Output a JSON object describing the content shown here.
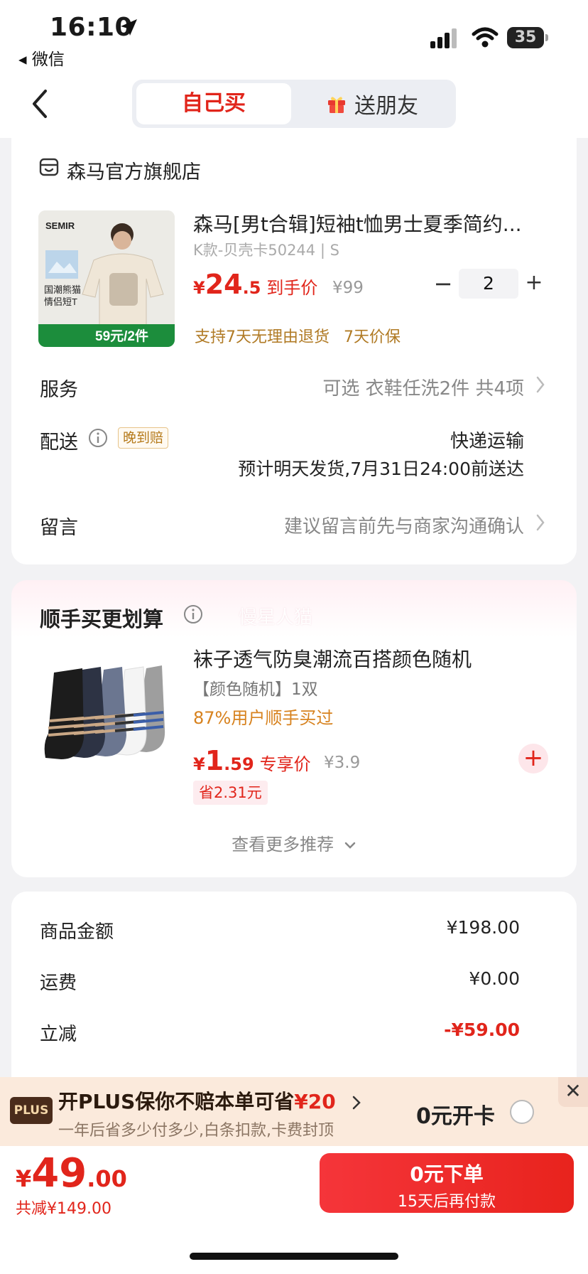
{
  "status_bar": {
    "time": "16:10",
    "back_app": "◂ 微信",
    "battery": "35"
  },
  "header": {
    "tab_self": "自己买",
    "tab_friend": "送朋友"
  },
  "store": {
    "name": "森马官方旗舰店"
  },
  "product": {
    "title": "森马[男t合辑]短袖t恤男士夏季简约...",
    "spec": "K款-贝壳卡50244 | S",
    "price_symbol": "¥",
    "price_int": "24",
    "price_dec": ".5",
    "price_tag": "到手价",
    "orig_price": "¥99",
    "qty_minus": "−",
    "qty": "2",
    "qty_plus": "+",
    "promise_1": "支持7天无理由退货",
    "promise_2": "7天价保",
    "image_text": {
      "brand": "SEMIR",
      "slogan_1": "国潮熊猫",
      "slogan_2": "情侣短T",
      "badge": "59元/2件"
    }
  },
  "service": {
    "label": "服务",
    "value": "可选 衣鞋任洗2件 共4项"
  },
  "delivery": {
    "label": "配送",
    "badge": "晚到赔",
    "method": "快递运输",
    "eta": "预计明天发货,7月31日24:00前送达"
  },
  "message": {
    "label": "留言",
    "placeholder": "建议留言前先与商家沟通确认"
  },
  "recommend": {
    "title": "顺手买更划算",
    "watermark": "慢星人猫",
    "item": {
      "title": "袜子透气防臭潮流百搭颜色随机",
      "spec": "【颜色随机】1双",
      "bought": "87%用户顺手买过",
      "price_symbol": "¥",
      "price_int": "1",
      "price_dec": ".59",
      "price_tag": "专享价",
      "orig_price": "¥3.9",
      "save": "省2.31元",
      "add": "+"
    },
    "more": "查看更多推荐"
  },
  "summary": [
    {
      "label": "商品金额",
      "value": "¥198.00",
      "red": false
    },
    {
      "label": "运费",
      "value": "¥0.00",
      "red": false
    },
    {
      "label": "立减",
      "value": "-¥59.00",
      "red": true
    }
  ],
  "plus": {
    "badge": "PLUS",
    "title_prefix": "开PLUS保你不赔本单可省",
    "title_save": "¥20",
    "subtitle": "一年后省多少付多少,白条扣款,卡费封顶",
    "open": "0元开卡",
    "close": "✕"
  },
  "footer": {
    "total_symbol": "¥",
    "total_int": "49",
    "total_dec": ".00",
    "saved": "共减¥149.00",
    "order_line1": "0元下单",
    "order_line2": "15天后再付款"
  },
  "colors": {
    "accent": "#e1251b",
    "promise": "#b07a24",
    "plus_bg": "#fbeadc"
  }
}
